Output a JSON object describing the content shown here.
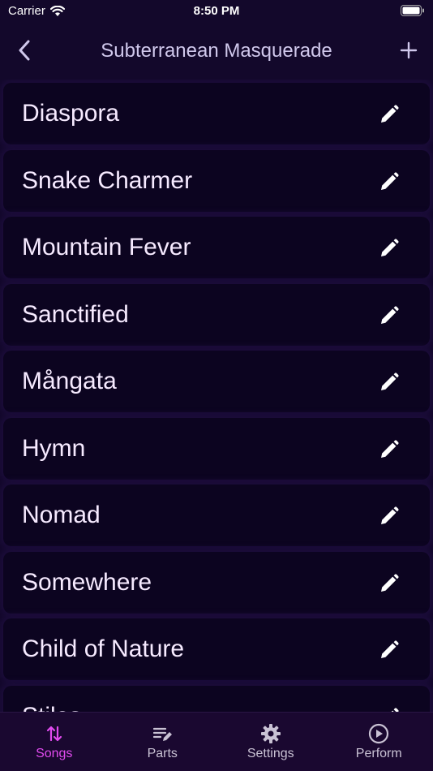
{
  "status_bar": {
    "carrier": "Carrier",
    "time": "8:50 PM"
  },
  "nav": {
    "title": "Subterranean Masquerade"
  },
  "songs": [
    {
      "title": "Diaspora"
    },
    {
      "title": "Snake Charmer"
    },
    {
      "title": "Mountain Fever"
    },
    {
      "title": "Sanctified"
    },
    {
      "title": "Mångata"
    },
    {
      "title": "Hymn"
    },
    {
      "title": "Nomad"
    },
    {
      "title": "Somewhere"
    },
    {
      "title": "Child of Nature"
    },
    {
      "title": "Stiles"
    }
  ],
  "tabs": [
    {
      "label": "Songs",
      "icon": "sort-arrows-icon",
      "active": true
    },
    {
      "label": "Parts",
      "icon": "list-edit-icon",
      "active": false
    },
    {
      "label": "Settings",
      "icon": "gear-icon",
      "active": false
    },
    {
      "label": "Perform",
      "icon": "play-circle-icon",
      "active": false
    }
  ],
  "colors": {
    "background": "#13082b",
    "row": "#0c0420",
    "accent": "#e24bf0",
    "tab_bar": "#1a0830"
  }
}
